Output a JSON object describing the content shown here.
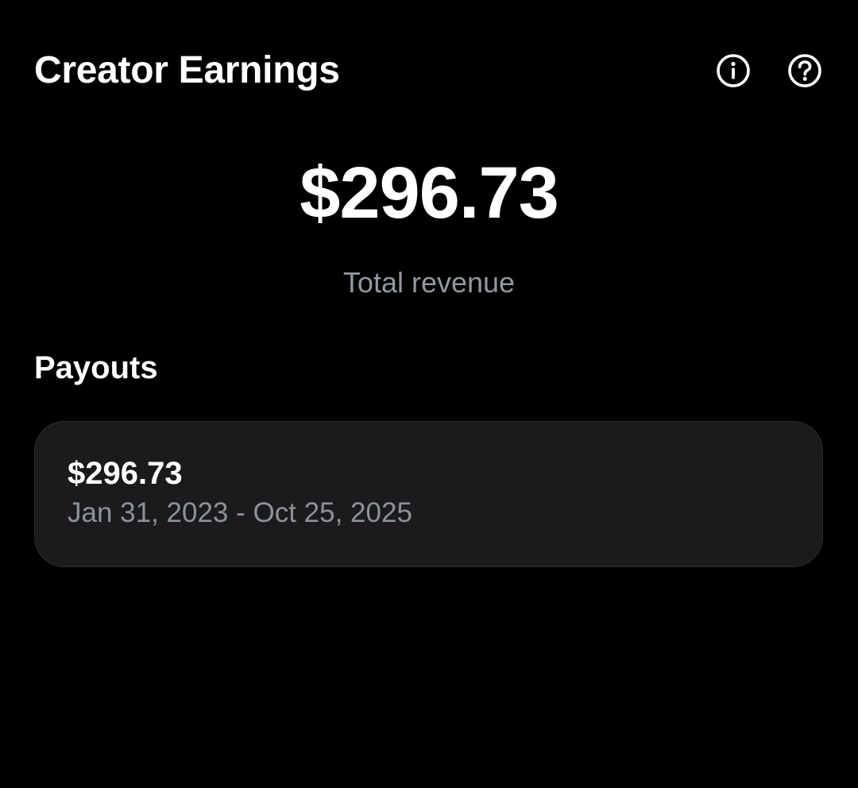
{
  "header": {
    "title": "Creator Earnings",
    "actions": [
      {
        "icon": "info-icon"
      },
      {
        "icon": "help-icon"
      }
    ]
  },
  "summary": {
    "total_amount": "$296.73",
    "total_label": "Total revenue"
  },
  "payouts": {
    "section_title": "Payouts",
    "items": [
      {
        "amount": "$296.73",
        "date_range": "Jan 31, 2023 - Oct 25, 2025"
      }
    ]
  },
  "colors": {
    "background": "#000000",
    "primary_text": "#ffffff",
    "secondary_text": "#8b929a",
    "card_background": "#1b1b1d",
    "card_border": "#2b2c30"
  }
}
